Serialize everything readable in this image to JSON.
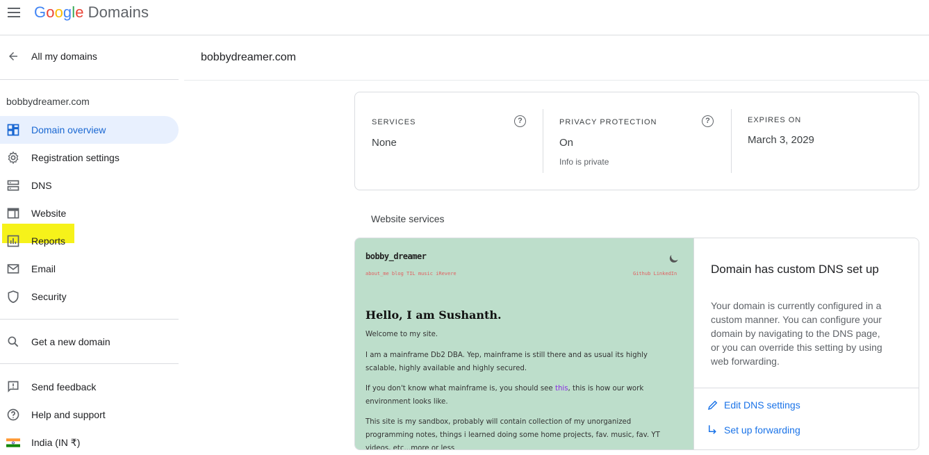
{
  "app": {
    "logo_letters": [
      "G",
      "o",
      "o",
      "g",
      "l",
      "e"
    ],
    "product": "Domains"
  },
  "sidebar": {
    "back_label": "All my domains",
    "domain_heading": "bobbydreamer.com",
    "items": [
      {
        "label": "Domain overview",
        "icon": "dashboard-icon",
        "active": true
      },
      {
        "label": "Registration settings",
        "icon": "gear-icon",
        "active": false
      },
      {
        "label": "DNS",
        "icon": "dns-icon",
        "active": false
      },
      {
        "label": "Website",
        "icon": "website-icon",
        "active": false
      },
      {
        "label": "Reports",
        "icon": "reports-icon",
        "active": false
      },
      {
        "label": "Email",
        "icon": "mail-icon",
        "active": false
      },
      {
        "label": "Security",
        "icon": "shield-icon",
        "active": false
      }
    ],
    "get_new_domain": "Get a new domain",
    "footer_items": [
      {
        "label": "Send feedback",
        "icon": "feedback-icon"
      },
      {
        "label": "Help and support",
        "icon": "help-icon"
      },
      {
        "label": "India (IN ₹)",
        "icon": "india-flag-icon"
      }
    ],
    "highlight_color": "#f6f21a"
  },
  "header": {
    "title": "bobbydreamer.com"
  },
  "overview": {
    "services": {
      "caption": "SERVICES",
      "value": "None"
    },
    "privacy": {
      "caption": "PRIVACY PROTECTION",
      "value": "On",
      "sub": "Info is private"
    },
    "expires": {
      "caption": "EXPIRES ON",
      "value": "March 3, 2029"
    }
  },
  "website_services": {
    "section_label": "Website services",
    "preview": {
      "brand": "bobby_dreamer",
      "nav_links": "about_me   blog   TIL   music   iRevere",
      "social_links": "Github   LinkedIn",
      "heading": "Hello, I am Sushanth.",
      "p1": "Welcome to my site.",
      "p2": "I am a mainframe Db2 DBA. Yep, mainframe is still there and as usual its highly scalable, highly available and highly secured.",
      "p3_before": "If you don't know what mainframe is, you should see ",
      "p3_link": "this",
      "p3_after": ", this is how our work environment looks like.",
      "p4": "This site is my sandbox, probably will contain collection of my unorganized programming notes, things i learned doing some home projects, fav. music, fav. YT videos, etc...more or less"
    },
    "dns": {
      "title": "Domain has custom DNS set up",
      "body": "Your domain is currently configured in a custom manner. You can configure your domain by navigating to the DNS page, or you can override this setting by using web forwarding.",
      "edit_label": "Edit DNS settings",
      "forward_label": "Set up forwarding"
    }
  },
  "colors": {
    "accent": "#1a73e8",
    "active_bg": "#e8f0fe",
    "preview_bg": "#bddecb"
  }
}
